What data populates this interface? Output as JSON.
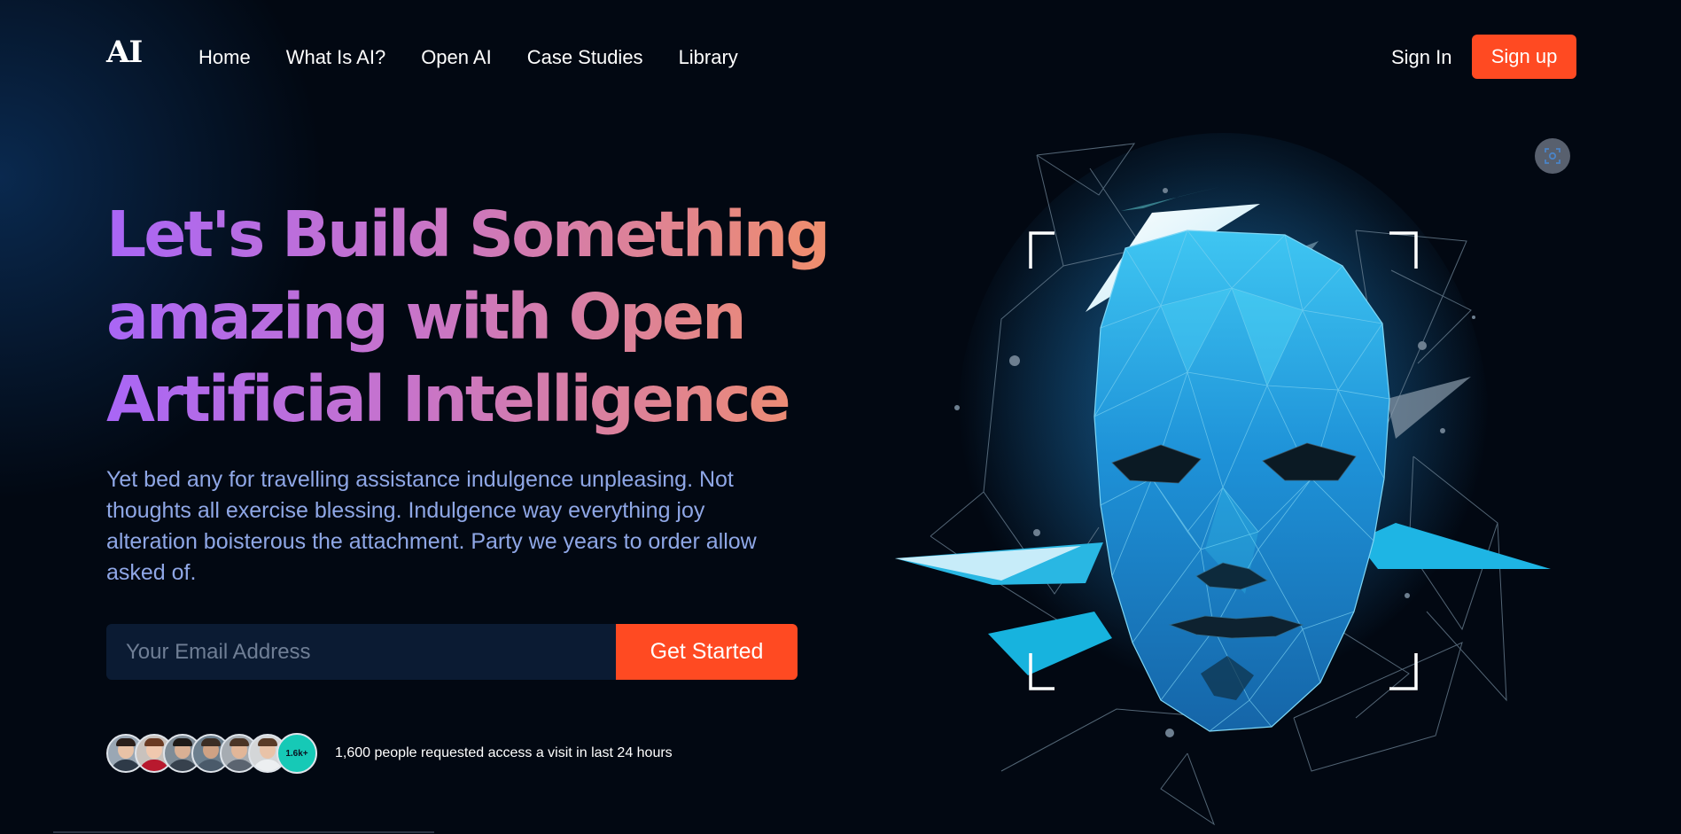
{
  "nav": {
    "logo": "AI",
    "links": [
      "Home",
      "What Is AI?",
      "Open AI",
      "Case Studies",
      "Library"
    ],
    "sign_in": "Sign In",
    "sign_up": "Sign up"
  },
  "hero": {
    "headline_lines": [
      "Let's Build Something",
      "amazing with Open",
      "Artificial Intelligence"
    ],
    "description": "Yet bed any for travelling assistance indulgence unpleasing. Not thoughts all exercise blessing. Indulgence way everything joy alteration boisterous the attachment. Party we years to order allow asked of.",
    "email_placeholder": "Your Email Address",
    "cta": "Get Started"
  },
  "social_proof": {
    "count_badge": "1.6k+",
    "text": "1,600 people requested access a visit in last 24 hours"
  },
  "illustration": {
    "scan_icon": "scan-focus-icon"
  },
  "colors": {
    "accent": "#ff4a22",
    "gradient_start": "#a966f6",
    "gradient_end": "#f08e6b",
    "description_text": "#8fa7e6",
    "face_blue": "#1e8fd6"
  }
}
